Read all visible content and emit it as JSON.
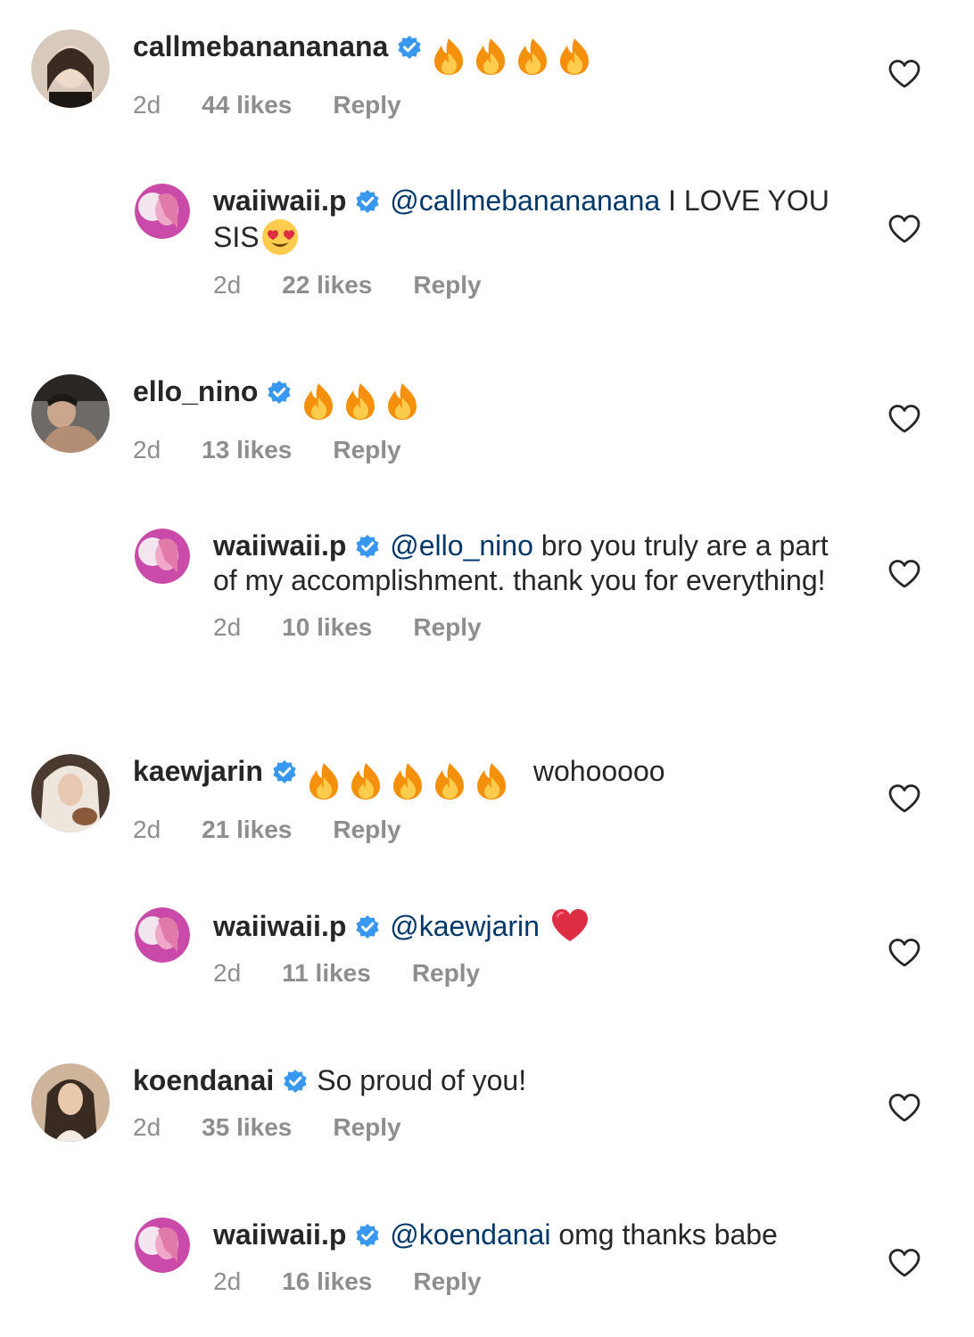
{
  "comments": [
    {
      "user": "callmebanananana",
      "verified": true,
      "emoji_count": 4,
      "time": "2d",
      "likes": "44 likes",
      "reply": "Reply",
      "avatar_colors": [
        "#d8c9bd",
        "#3a2a22"
      ]
    },
    {
      "user": "waiiwaii.p",
      "verified": true,
      "mention": "@callmebanananana",
      "text": " I LOVE YOU SIS",
      "trailing_emoji": "heart-eyes-emoji",
      "time": "2d",
      "likes": "22 likes",
      "reply": "Reply",
      "avatar_colors": [
        "#c94aa8",
        "#f0a8c8"
      ]
    },
    {
      "user": "ello_nino",
      "verified": true,
      "emoji_count": 3,
      "time": "2d",
      "likes": "13 likes",
      "reply": "Reply",
      "avatar_colors": [
        "#6d6a68",
        "#2a2624"
      ]
    },
    {
      "user": "waiiwaii.p",
      "verified": true,
      "mention": "@ello_nino",
      "text": " bro you truly are a part of my accomplishment. thank you for everything!",
      "time": "2d",
      "likes": "10 likes",
      "reply": "Reply",
      "avatar_colors": [
        "#c94aa8",
        "#f0a8c8"
      ]
    },
    {
      "user": "kaewjarin",
      "verified": true,
      "emoji_count": 5,
      "text_after": "wohooooo",
      "time": "2d",
      "likes": "21 likes",
      "reply": "Reply",
      "avatar_colors": [
        "#e9e4dc",
        "#6a4a34"
      ]
    },
    {
      "user": "waiiwaii.p",
      "verified": true,
      "mention": "@kaewjarin",
      "trailing_emoji": "red-heart-emoji",
      "time": "2d",
      "likes": "11 likes",
      "reply": "Reply",
      "avatar_colors": [
        "#c94aa8",
        "#f0a8c8"
      ]
    },
    {
      "user": "koendanai",
      "verified": true,
      "text": "So proud of you!",
      "time": "2d",
      "likes": "35 likes",
      "reply": "Reply",
      "avatar_colors": [
        "#cdb49a",
        "#3a2b22"
      ]
    },
    {
      "user": "waiiwaii.p",
      "verified": true,
      "mention": "@koendanai",
      "text": " omg thanks babe",
      "time": "2d",
      "likes": "16 likes",
      "reply": "Reply",
      "avatar_colors": [
        "#c94aa8",
        "#f0a8c8"
      ]
    }
  ],
  "colors": {
    "text": "#262626",
    "meta": "#8e8e8e",
    "mention": "#00376b",
    "verified": "#3897f0",
    "heart_outline": "#262626"
  },
  "icons": {
    "verified": "verified-badge-icon",
    "like": "heart-outline-icon",
    "fire": "fire-emoji"
  }
}
